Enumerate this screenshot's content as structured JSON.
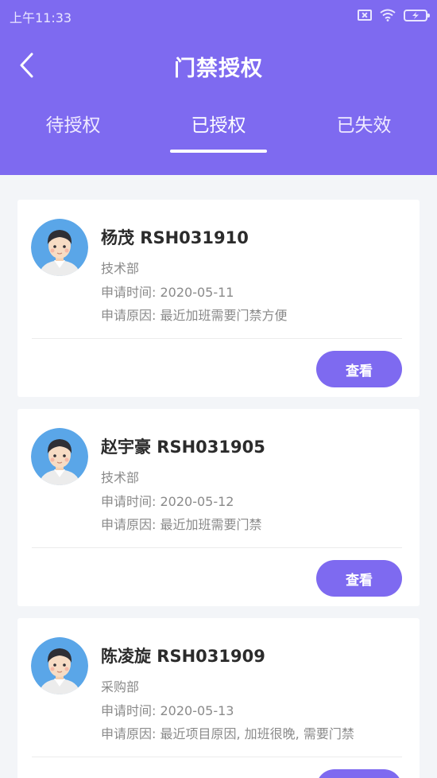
{
  "status_bar": {
    "time": "上午11:33"
  },
  "header": {
    "title": "门禁授权"
  },
  "tabs": [
    {
      "label": "待授权"
    },
    {
      "label": "已授权"
    },
    {
      "label": "已失效"
    }
  ],
  "colors": {
    "accent": "#7e6af0",
    "header_bg": "#7e6af0",
    "page_bg": "#f3f5f8"
  },
  "cards": [
    {
      "name_id": "杨茂 RSH031910",
      "dept": "技术部",
      "time_label": "申请时间:",
      "time_value": "2020-05-11",
      "reason_label": "申请原因:",
      "reason_value": "最近加班需要门禁方便",
      "button": "查看"
    },
    {
      "name_id": "赵宇豪 RSH031905",
      "dept": "技术部",
      "time_label": "申请时间:",
      "time_value": "2020-05-12",
      "reason_label": "申请原因:",
      "reason_value": "最近加班需要门禁",
      "button": "查看"
    },
    {
      "name_id": "陈凌旋 RSH031909",
      "dept": "采购部",
      "time_label": "申请时间:",
      "time_value": "2020-05-13",
      "reason_label": "申请原因:",
      "reason_value": "最近项目原因, 加班很晚, 需要门禁",
      "button": "查看"
    }
  ]
}
